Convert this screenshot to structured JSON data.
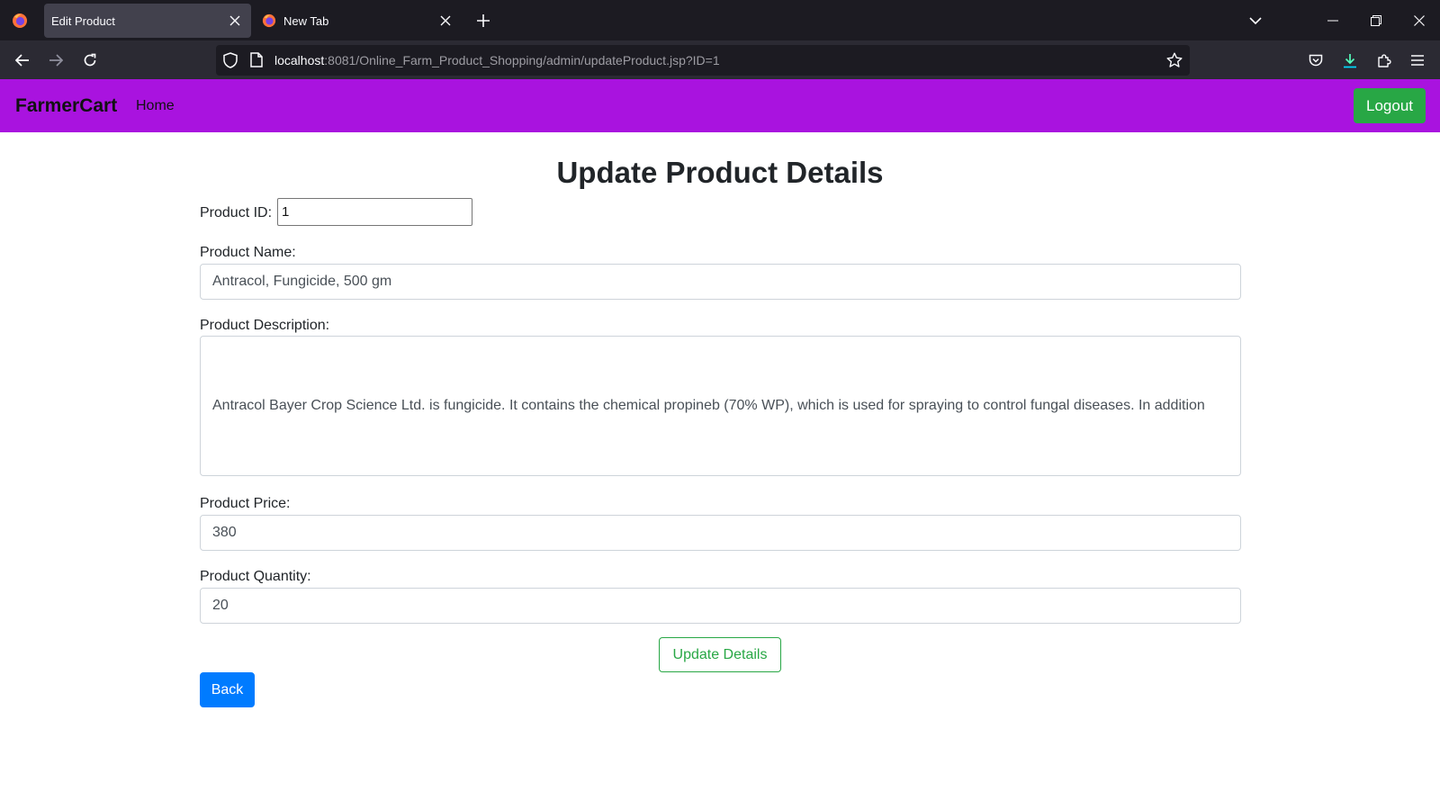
{
  "browser": {
    "tabs": [
      {
        "title": "Edit Product",
        "active": true
      },
      {
        "title": "New Tab",
        "active": false
      }
    ],
    "url": {
      "host": "localhost",
      "rest": ":8081/Online_Farm_Product_Shopping/admin/updateProduct.jsp?ID=1"
    }
  },
  "site": {
    "brand": "FarmerCart",
    "nav_home": "Home",
    "logout_label": "Logout"
  },
  "form": {
    "title": "Update Product Details",
    "product_id_label": "Product ID:",
    "product_id_value": "1",
    "name_label": "Product Name:",
    "name_value": "Antracol, Fungicide, 500 gm",
    "description_label": "Product Description:",
    "description_value": "Antracol Bayer Crop Science Ltd. is fungicide. It contains the chemical propineb (70% WP), which is used for spraying to control fungal diseases. In addition",
    "price_label": "Product Price:",
    "price_value": "380",
    "quantity_label": "Product Quantity:",
    "quantity_value": "20",
    "update_label": "Update Details",
    "back_label": "Back"
  },
  "colors": {
    "nav_bg": "#a913df",
    "success": "#28a745",
    "primary": "#007bff"
  }
}
